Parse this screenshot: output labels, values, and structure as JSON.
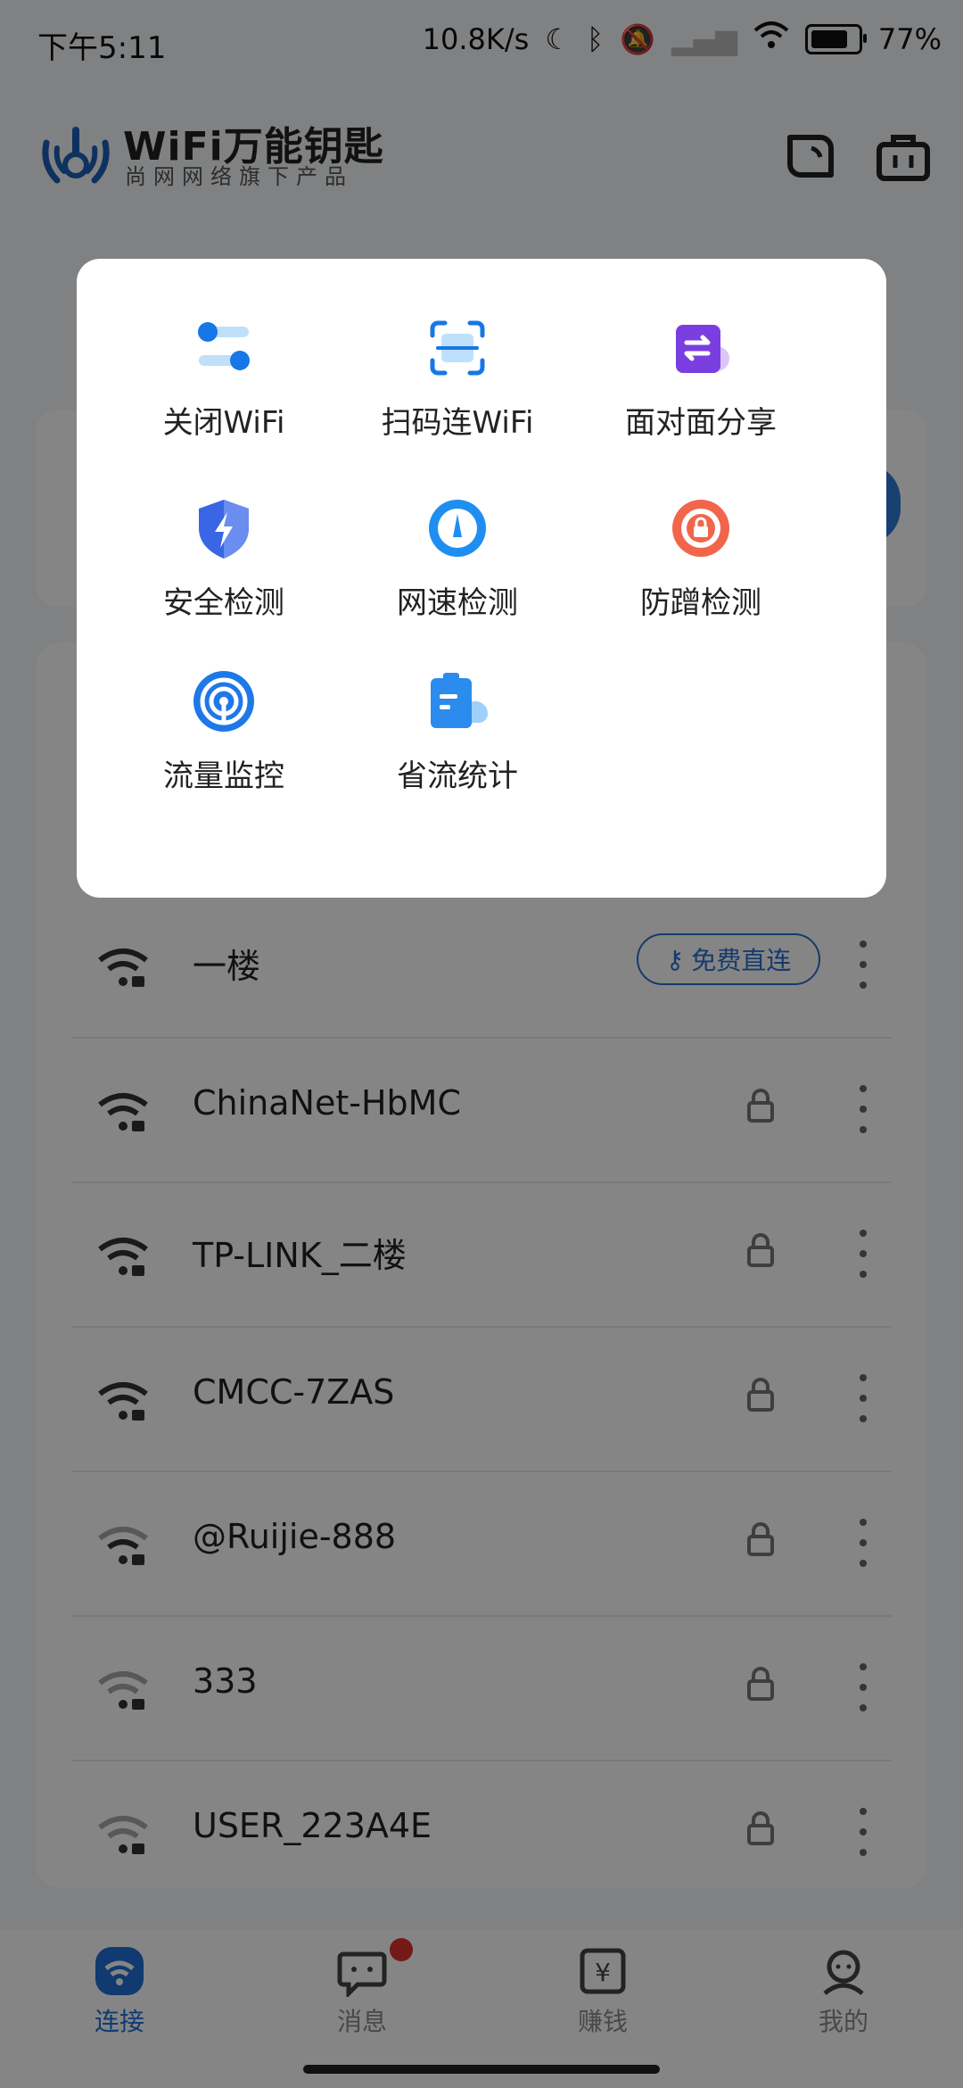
{
  "status_bar": {
    "time": "下午5:11",
    "speed": "10.8K/s",
    "battery": "77%"
  },
  "header": {
    "app_name": "WiFi万能钥匙",
    "subtitle": "尚网网络旗下产品"
  },
  "popup_menu": {
    "items": [
      {
        "label": "关闭WiFi",
        "icon": "toggle-icon"
      },
      {
        "label": "扫码连WiFi",
        "icon": "scan-icon"
      },
      {
        "label": "面对面分享",
        "icon": "share-icon"
      },
      {
        "label": "安全检测",
        "icon": "shield-icon"
      },
      {
        "label": "网速检测",
        "icon": "speed-gauge-icon"
      },
      {
        "label": "防蹭检测",
        "icon": "anti-leech-icon"
      },
      {
        "label": "流量监控",
        "icon": "traffic-monitor-icon"
      },
      {
        "label": "省流统计",
        "icon": "data-saving-icon"
      }
    ]
  },
  "wifi_list": {
    "rows": [
      {
        "ssid": "一楼",
        "action": "免费直连",
        "locked": false
      },
      {
        "ssid": "ChinaNet-HbMC",
        "locked": true
      },
      {
        "ssid": "TP-LINK_二楼",
        "locked": true
      },
      {
        "ssid": "CMCC-7ZAS",
        "locked": true
      },
      {
        "ssid": "@Ruijie-888",
        "locked": true
      },
      {
        "ssid": "333",
        "locked": true
      },
      {
        "ssid": "USER_223A4E",
        "locked": true
      }
    ]
  },
  "tabbar": {
    "tabs": [
      {
        "label": "连接",
        "active": true
      },
      {
        "label": "消息",
        "active": false
      },
      {
        "label": "赚钱",
        "active": false
      },
      {
        "label": "我的",
        "active": false
      }
    ]
  },
  "colors": {
    "accent": "#1f6fd6",
    "badge": "#e0302c",
    "dim_overlay": "rgba(0,0,0,0.48)"
  }
}
